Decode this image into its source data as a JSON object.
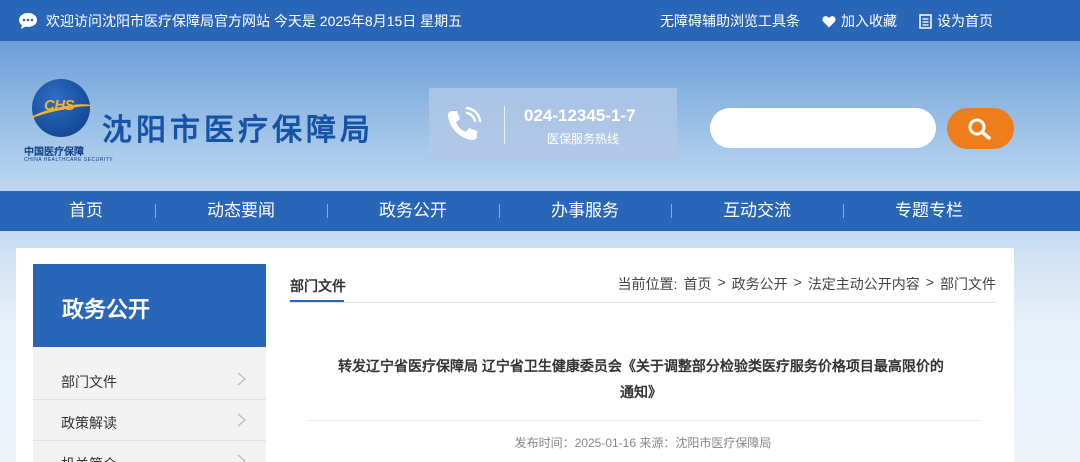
{
  "topbar": {
    "welcome": "欢迎访问沈阳市医疗保障局官方网站 今天是 2025年8月15日 星期五",
    "accessibility": "无障碍辅助浏览工具条",
    "favorite": "加入收藏",
    "homepage": "设为首页",
    "icons": [
      "chat-icon",
      "heart-icon",
      "document-icon"
    ]
  },
  "header": {
    "logo_title": "沈阳市医疗保障局",
    "logo_badge": "CHS",
    "logo_subtitle": "中国医疗保障",
    "logo_subtitle_en": "CHINA HEALTHCARE SECURITY",
    "hotline_number": "024-12345-1-7",
    "hotline_label": "医保服务热线",
    "search_placeholder": ""
  },
  "nav": {
    "items": [
      "首页",
      "动态要闻",
      "政务公开",
      "办事服务",
      "互动交流",
      "专题专栏"
    ]
  },
  "sidebar": {
    "title": "政务公开",
    "items": [
      "部门文件",
      "政策解读",
      "机关简介"
    ]
  },
  "breadcrumb": {
    "tab": "部门文件",
    "prefix": "当前位置:",
    "path": [
      "首页",
      "政务公开",
      "法定主动公开内容",
      "部门文件"
    ],
    "separator": ">"
  },
  "article": {
    "title": "转发辽宁省医疗保障局 辽宁省卫生健康委员会《关于调整部分检验类医疗服务价格项目最高限价的通知》",
    "meta": "发布时间：2025-01-16 来源：沈阳市医疗保障局"
  },
  "colors": {
    "primary": "#2a66b8",
    "accent": "#ee7d1b",
    "logo_gold": "#f3b42c"
  }
}
